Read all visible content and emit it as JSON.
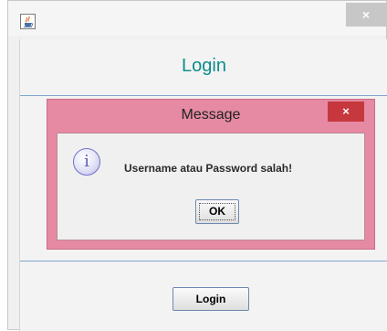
{
  "window": {
    "app_icon": "java-coffee-cup-icon",
    "close_glyph": "×"
  },
  "form": {
    "title": "Login",
    "login_button_label": "Login"
  },
  "dialog": {
    "title": "Message",
    "close_glyph": "×",
    "icon": "information-icon",
    "icon_glyph": "i",
    "message": "Username atau Password salah!",
    "ok_label": "OK"
  },
  "colors": {
    "title_accent": "#0f8c8c",
    "dialog_frame": "#e58aa2",
    "dialog_close": "#c7383e",
    "separator": "#7ea6cf"
  }
}
